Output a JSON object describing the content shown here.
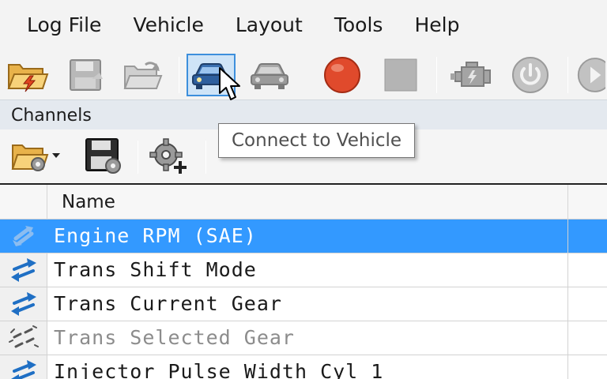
{
  "menu": {
    "items": [
      {
        "label": "Log File"
      },
      {
        "label": "Vehicle"
      },
      {
        "label": "Layout"
      },
      {
        "label": "Tools"
      },
      {
        "label": "Help"
      }
    ]
  },
  "toolbar": {
    "buttons": [
      {
        "icon": "open-log-folder-icon"
      },
      {
        "icon": "save-log-icon"
      },
      {
        "icon": "reload-log-icon"
      },
      {
        "icon": "connect-vehicle-icon",
        "active": true
      },
      {
        "icon": "disconnect-vehicle-icon"
      },
      {
        "icon": "record-icon",
        "color": "#e04a2c"
      },
      {
        "icon": "stop-icon"
      },
      {
        "icon": "engine-icon"
      },
      {
        "icon": "power-icon"
      },
      {
        "icon": "play-icon"
      }
    ],
    "tooltip": "Connect to Vehicle"
  },
  "channels": {
    "title": "Channels",
    "toolbar": [
      {
        "icon": "open-channels-folder-icon"
      },
      {
        "icon": "save-channels-icon"
      },
      {
        "icon": "add-channel-gear-icon"
      }
    ],
    "column_header": "Name",
    "rows": [
      {
        "name": "Engine RPM (SAE)",
        "state": "selected"
      },
      {
        "name": "Trans Shift Mode",
        "state": "normal"
      },
      {
        "name": "Trans Current Gear",
        "state": "normal"
      },
      {
        "name": "Trans Selected Gear",
        "state": "disabled"
      },
      {
        "name": "Injector Pulse Width Cyl 1",
        "state": "normal"
      }
    ]
  },
  "colors": {
    "selection": "#3399ff",
    "accent_blue": "#3d8fdc",
    "record_red": "#e04a2c"
  }
}
